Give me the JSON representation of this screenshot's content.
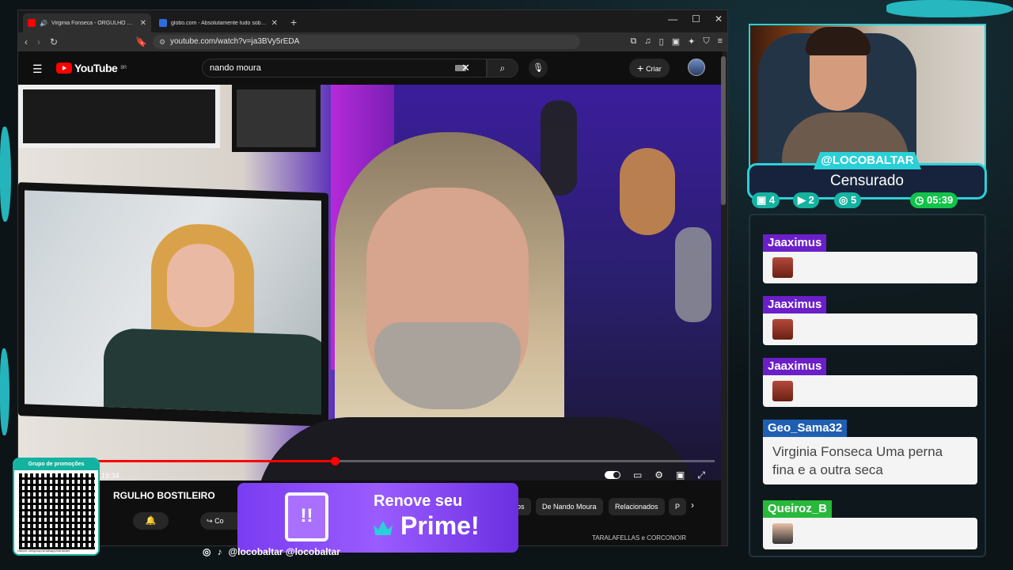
{
  "browser": {
    "tabs": [
      {
        "title": "Virginia Fonseca - ORGULHO BOSTI",
        "active": true,
        "favicon_color": "#ff0000"
      },
      {
        "title": "globo.com - Absolutamente tudo sobre not",
        "active": false,
        "favicon_color": "#2d6cdf"
      }
    ],
    "new_tab": "+",
    "url": "youtube.com/watch?v=ja3BVy5rEDA"
  },
  "youtube": {
    "logo": "YouTube",
    "region": "BR",
    "search_value": "nando moura",
    "create_label": "Criar",
    "time": "/ 19:34",
    "video_title": "RGULHO BOSTILEIRO",
    "share_label": "Co",
    "chips": [
      "os",
      "De Nando Moura",
      "Relacionados",
      "P"
    ],
    "related_snippet": "TARALAFELLAS e CORCONOIR"
  },
  "stream": {
    "handle": "@LOCOBALTAR",
    "status": "Censurado",
    "stats": {
      "twitch": "4",
      "youtube": "2",
      "kick": "5",
      "timer": "05:39"
    }
  },
  "chat": [
    {
      "user": "Jaaximus",
      "color": "#6a1fc9",
      "text": ""
    },
    {
      "user": "Jaaximus",
      "color": "#6a1fc9",
      "text": ""
    },
    {
      "user": "Jaaximus",
      "color": "#6a1fc9",
      "text": ""
    },
    {
      "user": "Geo_Sama32",
      "color": "#1f5fb3",
      "text": "Virginia Fonseca Uma perna fina e a outra seca"
    },
    {
      "user": "Queiroz_B",
      "color": "#28b83a",
      "text": ""
    }
  ],
  "overlay": {
    "qr_title": "Grupo de promoções",
    "qr_url": "rdstore.net/group/whatsapp/hardware",
    "prime_line1": "Renove seu",
    "prime_line2": "Prime!",
    "twitch_glyph": "!!",
    "socials": "@locobaltar   @locobaltar"
  }
}
